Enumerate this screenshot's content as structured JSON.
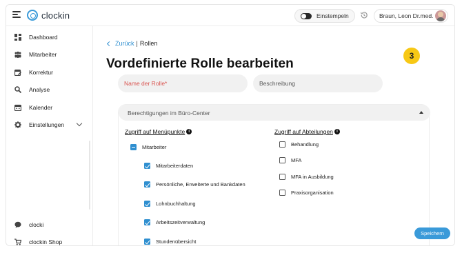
{
  "header": {
    "logo_text": "clockin",
    "clock_in_label": "Einstempeln",
    "user_name": "Braun, Leon Dr.med."
  },
  "sidebar": {
    "items": [
      {
        "label": "Dashboard",
        "icon": "dashboard-icon"
      },
      {
        "label": "Mitarbeiter",
        "icon": "employees-icon"
      },
      {
        "label": "Korrektur",
        "icon": "correction-icon"
      },
      {
        "label": "Analyse",
        "icon": "analysis-icon"
      },
      {
        "label": "Kalender",
        "icon": "calendar-icon"
      },
      {
        "label": "Einstellungen",
        "icon": "gear-icon"
      }
    ],
    "bottom_items": [
      {
        "label": "clocki",
        "icon": "chat-icon"
      },
      {
        "label": "clockin Shop",
        "icon": "cart-icon"
      }
    ]
  },
  "breadcrumb": {
    "back_label": "Zurück",
    "separator": "|",
    "current": "Rollen"
  },
  "page": {
    "title": "Vordefinierte Rolle bearbeiten",
    "step_badge": "3"
  },
  "form": {
    "name_placeholder": "Name der Rolle*",
    "description_placeholder": "Beschreibung"
  },
  "permissions": {
    "section_title": "Berechtigungen im Büro-Center",
    "menu_column_title": "Zugriff auf Menüpunkte",
    "department_column_title": "Zugriff auf Abteilungen",
    "menu_parent": {
      "label": "Mitarbeiter",
      "state": "indeterminate"
    },
    "menu_items": [
      {
        "label": "Mitarbeiterdaten",
        "checked": true
      },
      {
        "label": "Persönliche, Erweiterte und Bankdaten",
        "checked": true
      },
      {
        "label": "Lohnbuchhaltung",
        "checked": true
      },
      {
        "label": "Arbeitszeitverwaltung",
        "checked": true
      },
      {
        "label": "Stundenübersicht",
        "checked": true
      }
    ],
    "departments": [
      {
        "label": "Behandlung",
        "checked": false
      },
      {
        "label": "MFA",
        "checked": false
      },
      {
        "label": "MFA in Ausbildung",
        "checked": false
      },
      {
        "label": "Praxisorganisation",
        "checked": false
      }
    ]
  },
  "actions": {
    "save_label": "Speichern"
  },
  "colors": {
    "accent": "#3a9ad9",
    "badge": "#f7c815",
    "required_label": "#d9534f"
  }
}
